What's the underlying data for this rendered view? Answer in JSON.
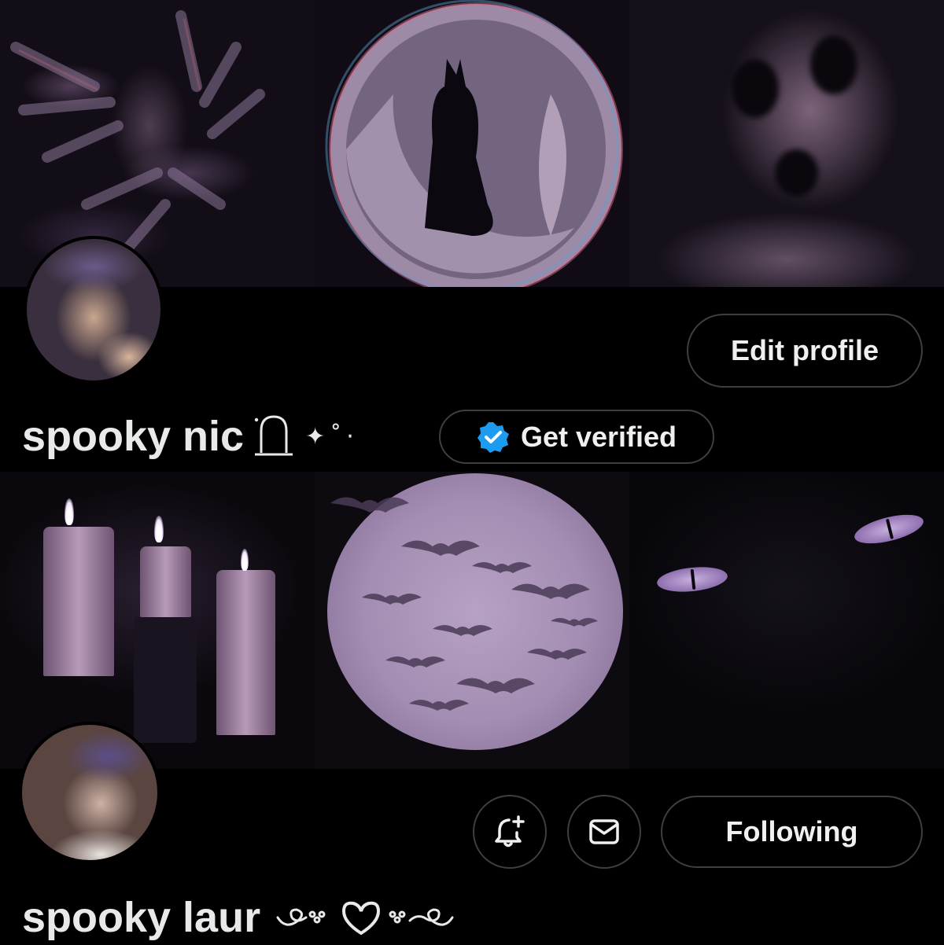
{
  "profile_top": {
    "display_name": "spooky nic",
    "name_decoration": "✦˚·",
    "edit_profile_label": "Edit profile",
    "get_verified_label": "Get verified"
  },
  "profile_bottom": {
    "display_name": "spooky laur",
    "name_decoration": "༺♡༻",
    "following_label": "Following"
  },
  "icons": {
    "verified_badge": "verified-badge-icon",
    "tombstone": "tombstone-icon",
    "notify": "bell-plus-icon",
    "message": "envelope-icon"
  },
  "colors": {
    "background": "#000000",
    "button_border": "#3c3f43",
    "text": "#e7e9ea",
    "verified_blue": "#1d9bf0"
  }
}
